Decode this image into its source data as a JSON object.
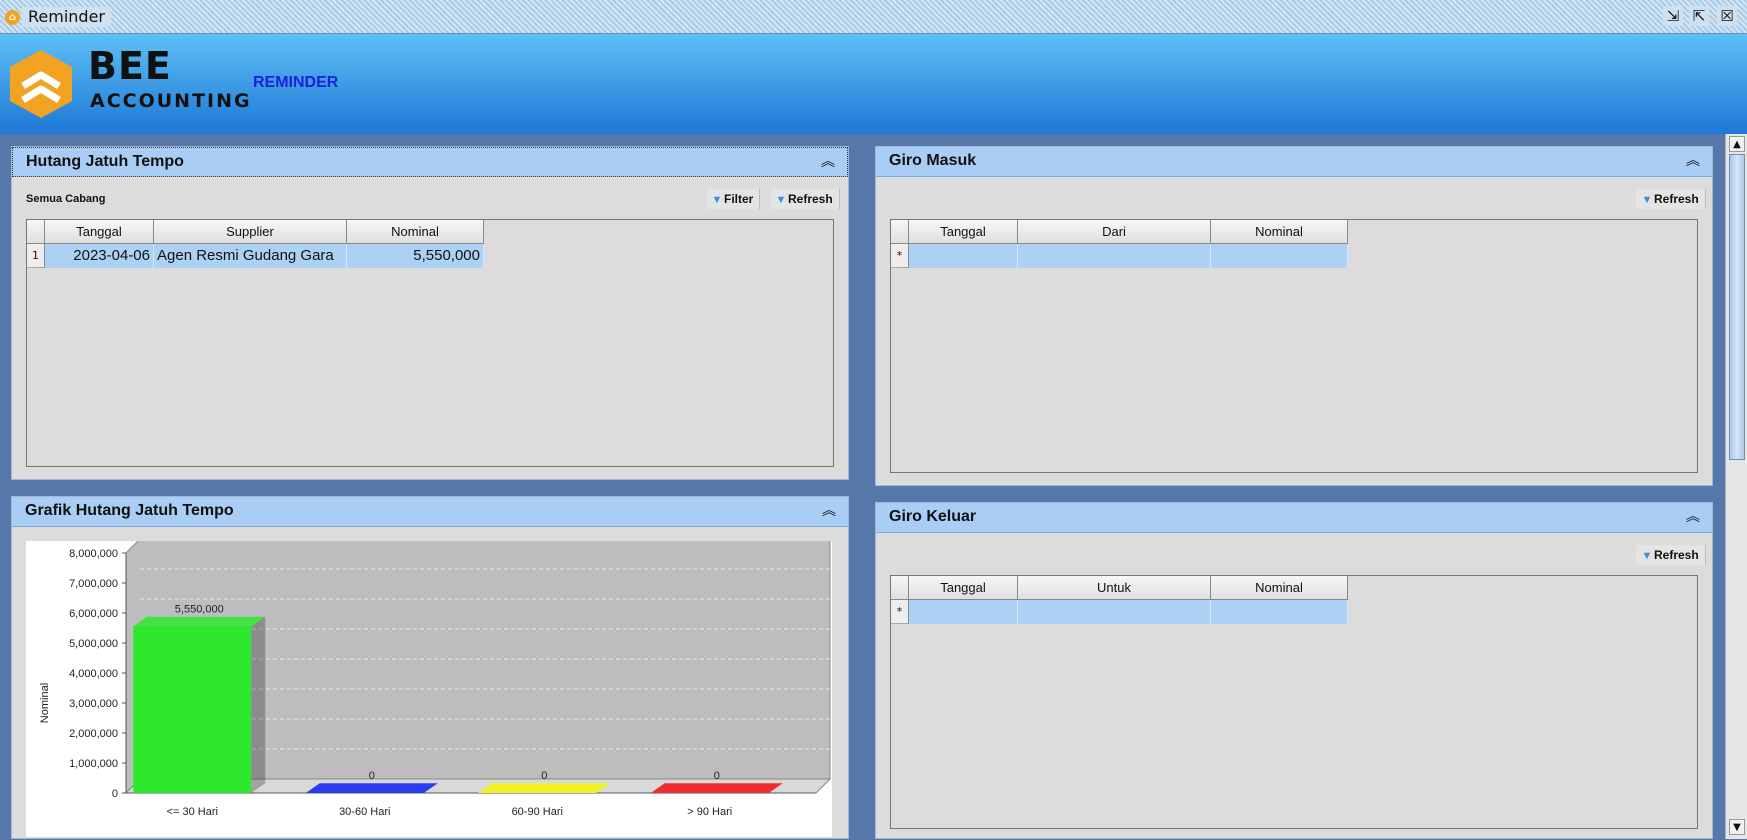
{
  "window": {
    "title": "Reminder",
    "controls": [
      "restore-icon",
      "popout-icon",
      "close-icon"
    ]
  },
  "banner": {
    "logo_line1": "BEE",
    "logo_line2": "ACCOUNTING",
    "label": "REMINDER",
    "colors": {
      "logo_orange": "#f2a322",
      "label": "#1a1fe0"
    }
  },
  "hutang_panel": {
    "title": "Hutang Jatuh Tempo",
    "branch": "Semua Cabang",
    "filter_label": "Filter",
    "refresh_label": "Refresh",
    "columns": [
      "Tanggal",
      "Supplier",
      "Nominal"
    ],
    "rows": [
      {
        "num": "1",
        "tanggal": "2023-04-06",
        "supplier": "Agen Resmi Gudang Gara",
        "nominal": "5,550,000"
      }
    ]
  },
  "giro_masuk_panel": {
    "title": "Giro Masuk",
    "refresh_label": "Refresh",
    "columns": [
      "Tanggal",
      "Dari",
      "Nominal"
    ],
    "new_row_marker": "*"
  },
  "giro_keluar_panel": {
    "title": "Giro Keluar",
    "refresh_label": "Refresh",
    "columns": [
      "Tanggal",
      "Untuk",
      "Nominal"
    ],
    "new_row_marker": "*"
  },
  "grafik_panel": {
    "title": "Grafik Hutang Jatuh Tempo"
  },
  "chart_data": {
    "type": "bar",
    "categories": [
      "<= 30 Hari",
      "30-60 Hari",
      "60-90 Hari",
      "> 90 Hari"
    ],
    "values": [
      5550000,
      0,
      0,
      0
    ],
    "data_labels": [
      "5,550,000",
      "0",
      "0",
      "0"
    ],
    "colors": [
      "#2ee82e",
      "#2a3cf0",
      "#f2f22a",
      "#ee2e2e"
    ],
    "ylabel": "Nominal",
    "ylim": [
      0,
      8000000
    ],
    "yticks": [
      0,
      1000000,
      2000000,
      3000000,
      4000000,
      5000000,
      6000000,
      7000000,
      8000000
    ],
    "ytick_labels": [
      "0",
      "1,000,000",
      "2,000,000",
      "3,000,000",
      "4,000,000",
      "5,000,000",
      "6,000,000",
      "7,000,000",
      "8,000,000"
    ],
    "grid": true,
    "style": "3d"
  }
}
